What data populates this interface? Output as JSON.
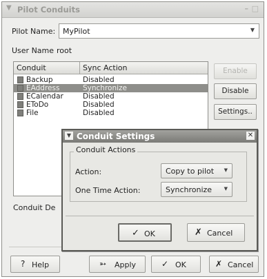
{
  "window": {
    "title": "Pilot Conduits",
    "menu_icon": "menu-arrow-icon"
  },
  "pilot": {
    "name_label": "Pilot Name:",
    "name_value": "MyPilot",
    "user_label": "User Name",
    "user_value": "root"
  },
  "conduits": {
    "headers": [
      "Conduit",
      "Sync Action"
    ],
    "rows": [
      {
        "name": "Backup",
        "action": "Disabled"
      },
      {
        "name": "EAddress",
        "action": "Synchronize"
      },
      {
        "name": "ECalendar",
        "action": "Disabled"
      },
      {
        "name": "EToDo",
        "action": "Disabled"
      },
      {
        "name": "File",
        "action": "Disabled"
      }
    ],
    "selected_index": 1
  },
  "side_buttons": {
    "enable": "Enable",
    "disable": "Disable",
    "settings": "Settings.."
  },
  "conduit_description_label": "Conduit De",
  "bottom_buttons": {
    "help": "Help",
    "apply": "Apply",
    "ok": "OK",
    "cancel": "Cancel"
  },
  "dialog": {
    "title": "Conduit Settings",
    "frame_label": "Conduit Actions",
    "action_label": "Action:",
    "action_value": "Copy to pilot",
    "one_time_label": "One Time Action:",
    "one_time_value": "Synchronize",
    "ok": "OK",
    "cancel": "Cancel"
  }
}
